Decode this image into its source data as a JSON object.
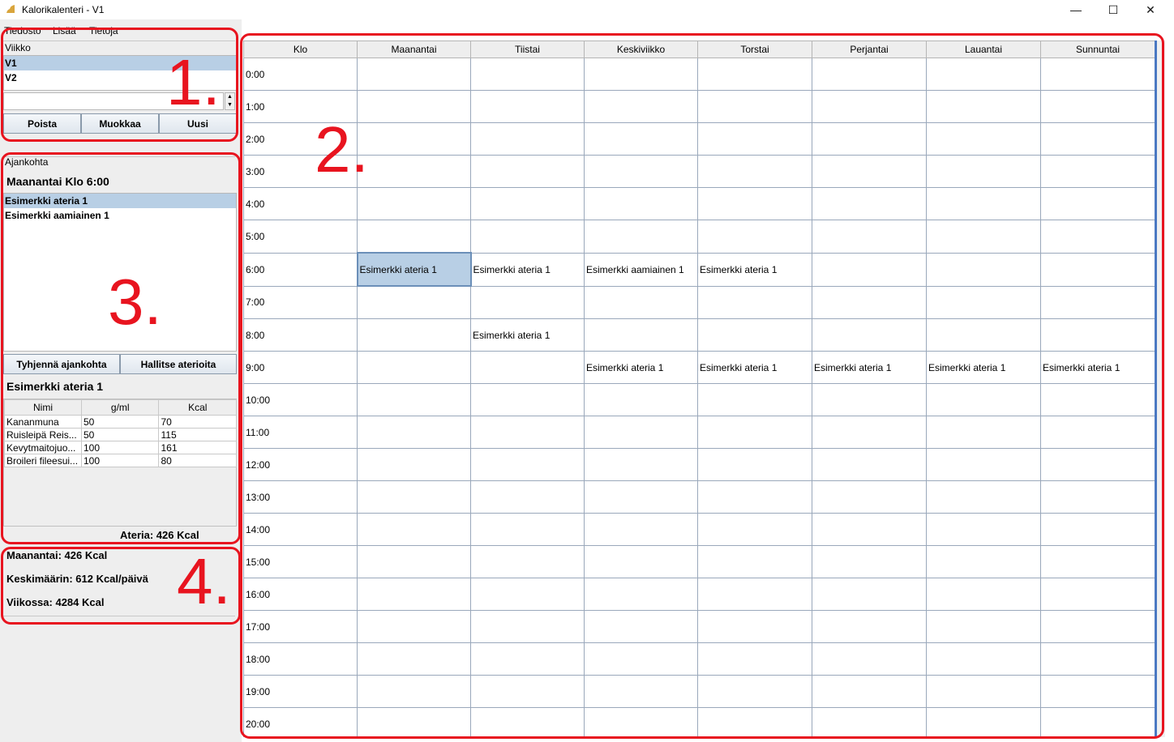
{
  "window": {
    "title": "Kalorikalenteri - V1",
    "minimize": "—",
    "maximize": "☐",
    "close": "✕"
  },
  "menu": [
    "Tiedosto",
    "Lisää",
    "Tietoja"
  ],
  "week_panel": {
    "label": "Viikko",
    "weeks": [
      "V1",
      "V2"
    ],
    "spinner_value": "",
    "buttons": {
      "delete": "Poista",
      "edit": "Muokkaa",
      "new": "Uusi"
    }
  },
  "time_panel": {
    "label": "Ajankohta",
    "current": "Maanantai Klo 6:00",
    "meals": [
      "Esimerkki ateria 1",
      "Esimerkki aamiainen 1"
    ],
    "buttons": {
      "clear": "Tyhjennä ajankohta",
      "manage": "Hallitse aterioita"
    },
    "meal_title": "Esimerkki ateria 1",
    "columns": [
      "Nimi",
      "g/ml",
      "Kcal"
    ],
    "rows": [
      [
        "Kananmuna",
        "50",
        "70"
      ],
      [
        "Ruisleipä Reis...",
        "50",
        "115"
      ],
      [
        "Kevytmaitojuo...",
        "100",
        "161"
      ],
      [
        "Broileri fileesui...",
        "100",
        "80"
      ]
    ],
    "meal_total": "Ateria: 426 Kcal"
  },
  "summary": {
    "day": "Maanantai: 426 Kcal",
    "average": "Keskimäärin: 612 Kcal/päivä",
    "week": "Viikossa: 4284 Kcal"
  },
  "calendar": {
    "columns": [
      "Klo",
      "Maanantai",
      "Tiistai",
      "Keskiviikko",
      "Torstai",
      "Perjantai",
      "Lauantai",
      "Sunnuntai"
    ],
    "hours": [
      "0:00",
      "1:00",
      "2:00",
      "3:00",
      "4:00",
      "5:00",
      "6:00",
      "7:00",
      "8:00",
      "9:00",
      "10:00",
      "11:00",
      "12:00",
      "13:00",
      "14:00",
      "15:00",
      "16:00",
      "17:00",
      "18:00",
      "19:00",
      "20:00"
    ],
    "entries": [
      {
        "hour": 6,
        "day": 0,
        "text": "Esimerkki ateria 1",
        "selected": true
      },
      {
        "hour": 6,
        "day": 1,
        "text": "Esimerkki ateria 1"
      },
      {
        "hour": 6,
        "day": 2,
        "text": "Esimerkki aamiainen 1"
      },
      {
        "hour": 6,
        "day": 3,
        "text": "Esimerkki ateria 1"
      },
      {
        "hour": 8,
        "day": 1,
        "text": "Esimerkki ateria 1"
      },
      {
        "hour": 9,
        "day": 2,
        "text": "Esimerkki ateria 1"
      },
      {
        "hour": 9,
        "day": 3,
        "text": "Esimerkki ateria 1"
      },
      {
        "hour": 9,
        "day": 4,
        "text": "Esimerkki ateria 1"
      },
      {
        "hour": 9,
        "day": 5,
        "text": "Esimerkki ateria 1"
      },
      {
        "hour": 9,
        "day": 6,
        "text": "Esimerkki ateria 1"
      }
    ]
  },
  "annotations": [
    "1.",
    "2.",
    "3.",
    "4."
  ],
  "colors": {
    "annotation": "#e8141f",
    "selection": "#b8cfe5"
  }
}
